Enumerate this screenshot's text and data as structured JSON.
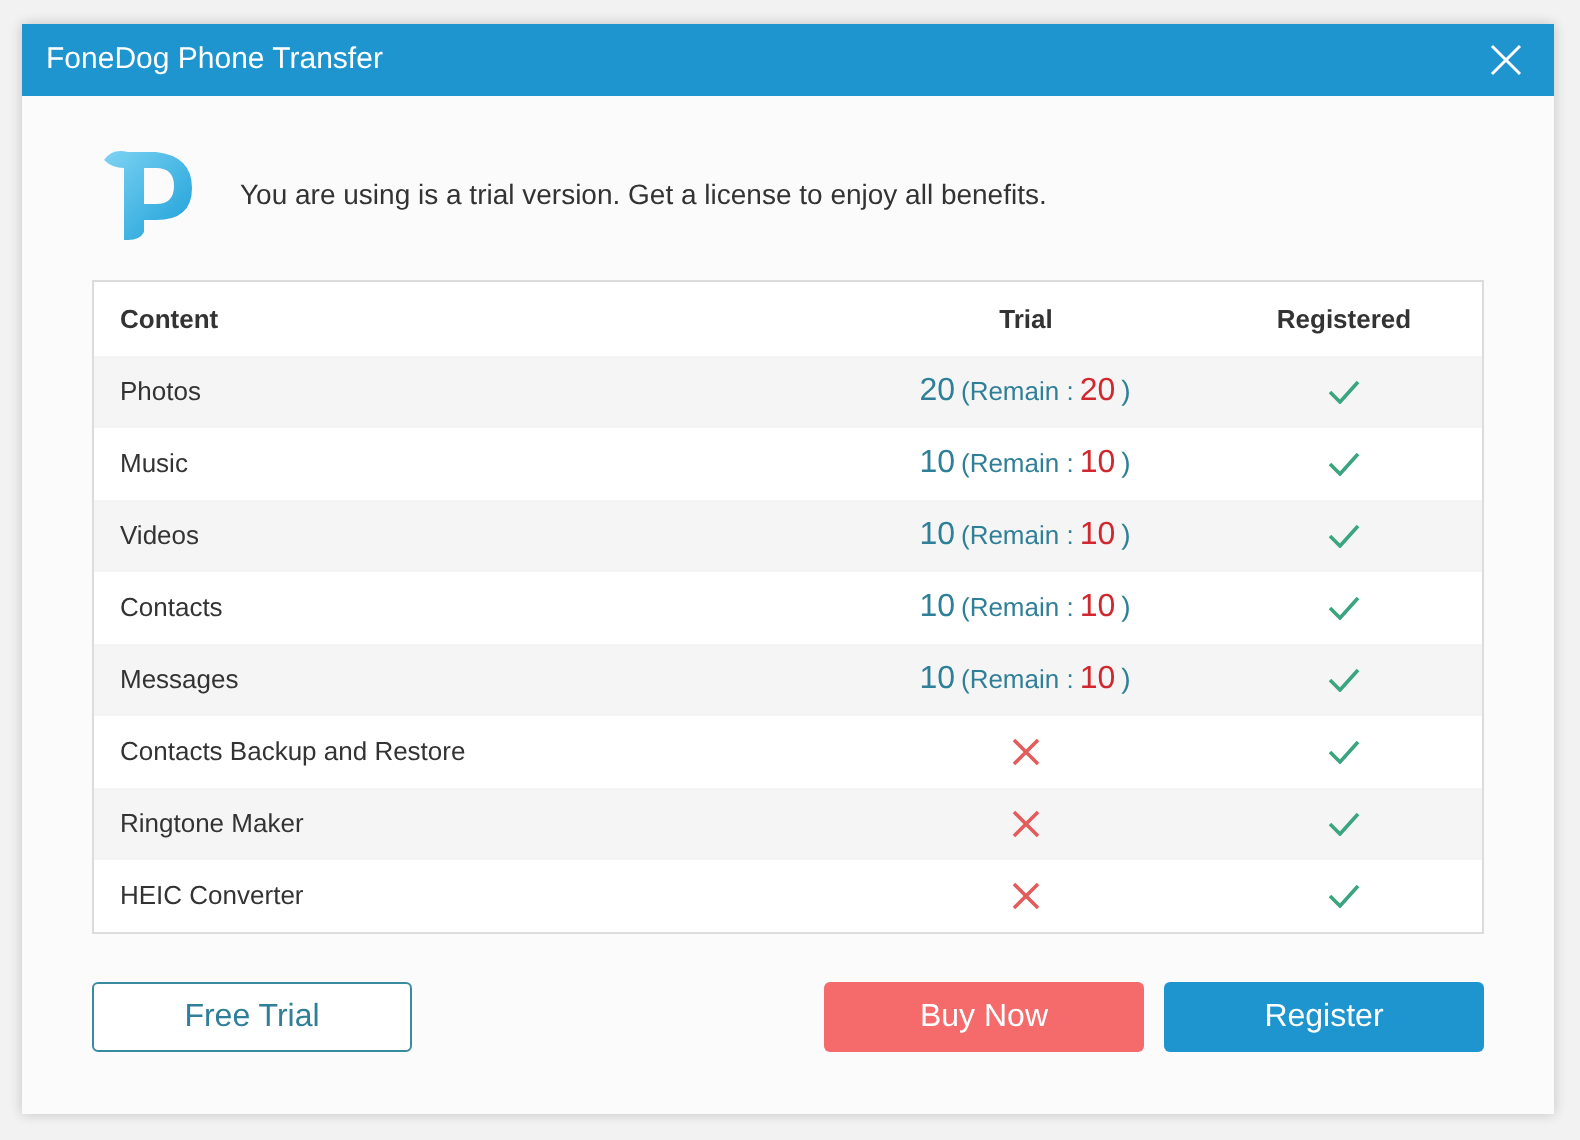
{
  "window": {
    "title": "FoneDog Phone Transfer"
  },
  "message": "You are using is a trial version. Get a license to enjoy all benefits.",
  "table": {
    "columns": [
      "Content",
      "Trial",
      "Registered"
    ],
    "rows": [
      {
        "content": "Photos",
        "trial": {
          "kind": "count",
          "value": "20",
          "remain_label": "(Remain :",
          "remain": "20",
          "close": ")"
        },
        "registered": true
      },
      {
        "content": "Music",
        "trial": {
          "kind": "count",
          "value": "10",
          "remain_label": "(Remain :",
          "remain": "10",
          "close": ")"
        },
        "registered": true
      },
      {
        "content": "Videos",
        "trial": {
          "kind": "count",
          "value": "10",
          "remain_label": "(Remain :",
          "remain": "10",
          "close": ")"
        },
        "registered": true
      },
      {
        "content": "Contacts",
        "trial": {
          "kind": "count",
          "value": "10",
          "remain_label": "(Remain :",
          "remain": "10",
          "close": ")"
        },
        "registered": true
      },
      {
        "content": "Messages",
        "trial": {
          "kind": "count",
          "value": "10",
          "remain_label": "(Remain :",
          "remain": "10",
          "close": ")"
        },
        "registered": true
      },
      {
        "content": "Contacts Backup and Restore",
        "trial": {
          "kind": "unavailable"
        },
        "registered": true
      },
      {
        "content": "Ringtone Maker",
        "trial": {
          "kind": "unavailable"
        },
        "registered": true
      },
      {
        "content": "HEIC Converter",
        "trial": {
          "kind": "unavailable"
        },
        "registered": true
      }
    ]
  },
  "buttons": [
    {
      "label": "Free Trial",
      "kind": "outline"
    },
    {
      "label": "Buy Now",
      "kind": "danger"
    },
    {
      "label": "Register",
      "kind": "primary"
    }
  ]
}
